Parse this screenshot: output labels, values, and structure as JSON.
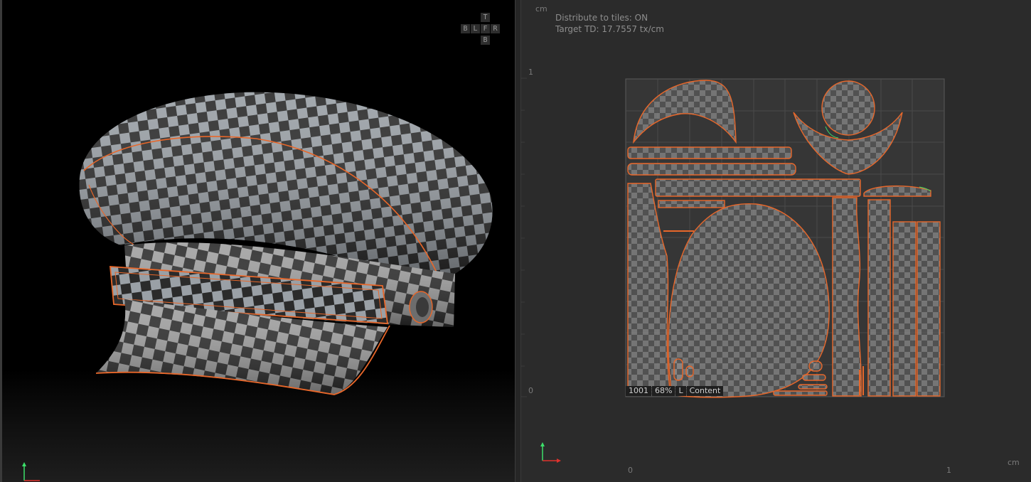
{
  "viewport3d": {
    "cube": {
      "top": "T",
      "back": "B",
      "left": "L",
      "front": "F",
      "right": "R",
      "bottom": "B"
    }
  },
  "uv_editor": {
    "unit_top": "cm",
    "unit_bottom": "cm",
    "info_distribute": "Distribute to tiles: ON",
    "info_td": "Target TD: 17.7557 tx/cm",
    "axis_v_1": "1",
    "axis_v_0": "0",
    "axis_u_0": "0",
    "axis_u_1": "1",
    "tile": {
      "id": "1001",
      "percent": "68%",
      "flag": "L",
      "name": "Content"
    }
  },
  "colors": {
    "outline": "#e8672a",
    "grid": "#4a4a4a",
    "gizmo_x": "#e0322d",
    "gizmo_y": "#3ce06a"
  }
}
